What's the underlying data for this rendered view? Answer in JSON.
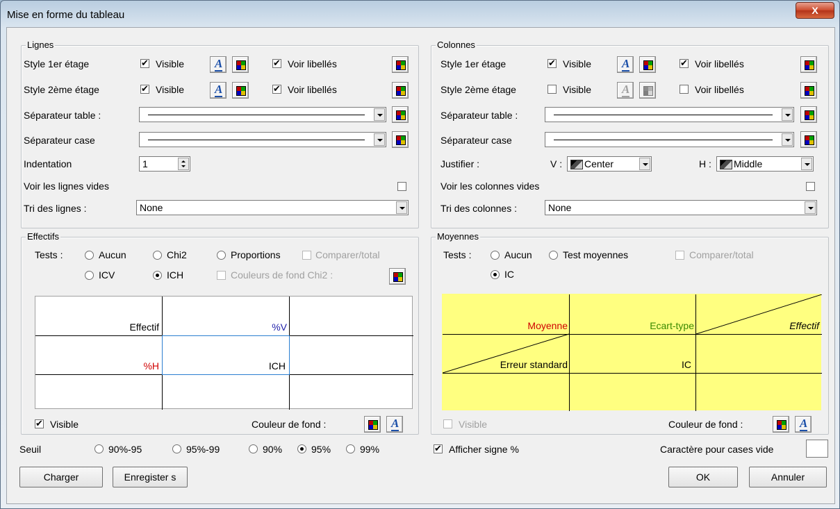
{
  "window": {
    "title": "Mise en forme du tableau",
    "close_label": "X"
  },
  "lignes": {
    "title": "Lignes",
    "style1_label": "Style 1er étage",
    "style2_label": "Style 2ème étage",
    "visible_label": "Visible",
    "voir_libelles_label": "Voir libellés",
    "sep_table_label": "Séparateur table :",
    "sep_case_label": "Séparateur case",
    "indent_label": "Indentation",
    "indent_value": "1",
    "voir_vides_label": "Voir les lignes vides",
    "tri_label": "Tri des lignes :",
    "tri_value": "None"
  },
  "colonnes": {
    "title": "Colonnes",
    "style1_label": "Style 1er étage",
    "style2_label": "Style 2ème étage",
    "visible_label": "Visible",
    "voir_libelles_label": "Voir libellés",
    "sep_table_label": "Séparateur table :",
    "sep_case_label": "Séparateur case",
    "justifier_label": "Justifier :",
    "v_label": "V :",
    "v_value": "Center",
    "h_label": "H :",
    "h_value": "Middle",
    "voir_vides_label": "Voir les colonnes vides",
    "tri_label": "Tri des colonnes :",
    "tri_value": "None"
  },
  "effectifs": {
    "title": "Effectifs",
    "tests_label": "Tests :",
    "opt_aucun": "Aucun",
    "opt_chi2": "Chi2",
    "opt_proportions": "Proportions",
    "opt_comparer": "Comparer/total",
    "opt_icv": "ICV",
    "opt_ich": "ICH",
    "opt_couleurs_chi2": "Couleurs de fond Chi2 :",
    "cell_effectif": "Effectif",
    "cell_pv": "%V",
    "cell_ph": "%H",
    "cell_ich": "ICH",
    "visible_label": "Visible",
    "couleur_fond_label": "Couleur de fond :"
  },
  "moyennes": {
    "title": "Moyennes",
    "tests_label": "Tests :",
    "opt_aucun": "Aucun",
    "opt_test_moy": "Test moyennes",
    "opt_comparer": "Comparer/total",
    "opt_ic": "IC",
    "cell_moyenne": "Moyenne",
    "cell_ecart": "Ecart-type",
    "cell_effectif": "Effectif",
    "cell_erreur": "Erreur standard",
    "cell_ic": "IC",
    "visible_label": "Visible",
    "couleur_fond_label": "Couleur de fond :"
  },
  "seuil": {
    "label": "Seuil",
    "opt_90_95": "90%-95",
    "opt_95_99": "95%-99",
    "opt_90": "90%",
    "opt_95": "95%",
    "opt_99": "99%"
  },
  "footer": {
    "afficher_signe": "Afficher signe %",
    "caractere_label": "Caractère pour cases vide",
    "charger": "Charger",
    "enregistrer": "Enregister s",
    "ok": "OK",
    "annuler": "Annuler"
  },
  "colors": {
    "red_text": "#d00000",
    "blue_text": "#1d1da8",
    "green_text": "#3a8a00",
    "yellow_grid": "#ffff80"
  }
}
